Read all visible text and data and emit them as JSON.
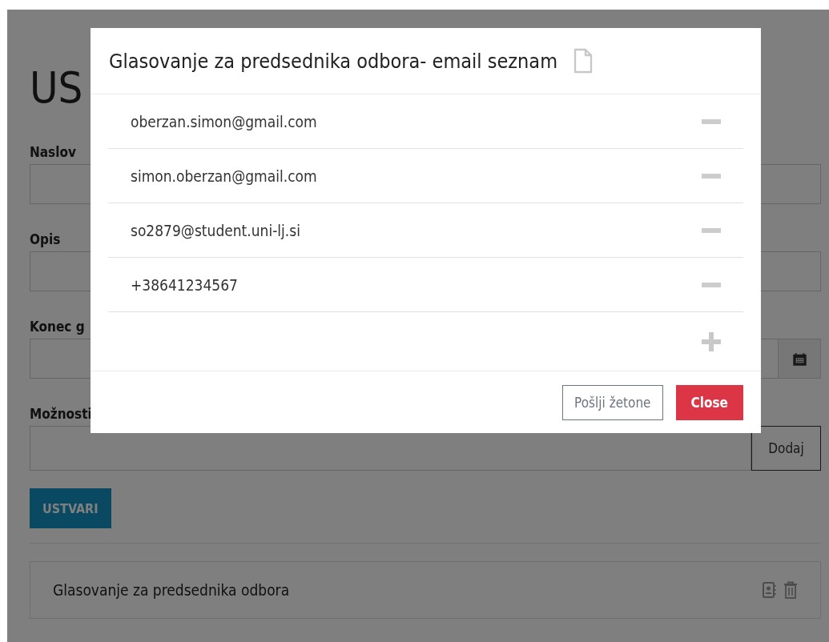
{
  "page": {
    "heading": "US",
    "fields": [
      {
        "label": "Naslov",
        "kind": "text"
      },
      {
        "label": "Opis",
        "kind": "text"
      },
      {
        "label": "Konec g",
        "kind": "date"
      },
      {
        "label": "Možnosti",
        "kind": "add",
        "button": "Dodaj"
      }
    ],
    "create_button": "USTVARI",
    "polls": [
      {
        "title": "Glasovanje za predsednika odbora"
      }
    ]
  },
  "modal": {
    "title": "Glasovanje za predsednika odbora- email seznam",
    "entries": [
      {
        "text": "oberzan.simon@gmail.com"
      },
      {
        "text": "simon.oberzan@gmail.com"
      },
      {
        "text": "so2879@student.uni-lj.si"
      },
      {
        "text": "+38641234567"
      }
    ],
    "buttons": [
      {
        "label": "Pošlji žetone",
        "kind": "secondary"
      },
      {
        "label": "Close",
        "kind": "danger"
      }
    ]
  }
}
